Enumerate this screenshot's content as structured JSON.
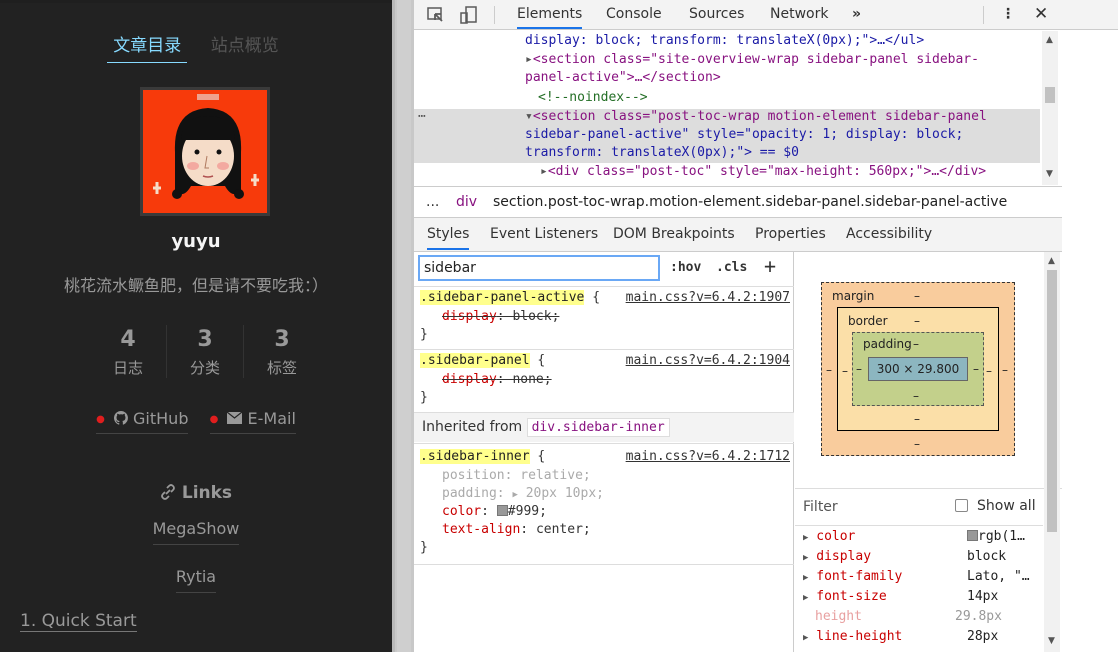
{
  "sidebar": {
    "tabs": {
      "toc": "文章目录",
      "overview": "站点概览"
    },
    "author": "yuyu",
    "description": "桃花流水鳜鱼肥，但是请不要吃我：）",
    "stats": [
      {
        "count": "4",
        "label": "日志"
      },
      {
        "count": "3",
        "label": "分类"
      },
      {
        "count": "3",
        "label": "标签"
      }
    ],
    "social": [
      {
        "label": "GitHub",
        "icon": "github-icon"
      },
      {
        "label": "E-Mail",
        "icon": "mail-icon"
      }
    ],
    "links_title": "Links",
    "links": [
      "MegaShow",
      "Rytia"
    ],
    "toc_item": "1. Quick Start"
  },
  "devtools": {
    "tabs": [
      "Elements",
      "Console",
      "Sources",
      "Network"
    ],
    "dom": {
      "line1": "display: block; transform: translateX(0px);\">…</ul>",
      "line2a": "<section class=\"site-overview-wrap sidebar-panel sidebar-",
      "line2b": "panel-active\">…</section>",
      "comment": "<!--noindex-->",
      "sel1": "<section class=\"post-toc-wrap motion-element sidebar-panel",
      "sel2": "sidebar-panel-active\" style=\"opacity: 1; display: block;",
      "sel3": "transform: translateX(0px);\"> == $0",
      "line5": "<div class=\"post-toc\" style=\"max-height: 560px;\">…</div>"
    },
    "breadcrumb": {
      "dots": "...",
      "div": "div",
      "current": "section.post-toc-wrap.motion-element.sidebar-panel.sidebar-panel-active"
    },
    "subtabs": [
      "Styles",
      "Event Listeners",
      "DOM Breakpoints",
      "Properties",
      "Accessibility"
    ],
    "filter_value": "sidebar",
    "hov": ":hov",
    "cls": ".cls",
    "rules": [
      {
        "selector": ".sidebar-panel-active",
        "source": "main.css?v=6.4.2:1907",
        "props": [
          {
            "name": "display",
            "value": "block;"
          }
        ]
      },
      {
        "selector": ".sidebar-panel",
        "source": "main.css?v=6.4.2:1904",
        "props": [
          {
            "name": "display",
            "value": "none;"
          }
        ]
      },
      {
        "selector": ".sidebar-inner",
        "source": "main.css?v=6.4.2:1712",
        "props": [
          {
            "name": "position",
            "value": "relative;"
          },
          {
            "name": "padding",
            "value": "20px 10px;"
          },
          {
            "name": "color",
            "value": "#999;"
          },
          {
            "name": "text-align",
            "value": "center;"
          }
        ]
      }
    ],
    "inherited_label": "Inherited from",
    "inherited_tag": "div.sidebar-inner",
    "boxmodel": {
      "margin": "margin",
      "border": "border",
      "padding": "padding",
      "content": "300 × 29.800",
      "dash": "–"
    },
    "computed_filter": "Filter",
    "show_all": "Show all",
    "computed": [
      {
        "name": "color",
        "value": "rgb(1…"
      },
      {
        "name": "display",
        "value": "block"
      },
      {
        "name": "font-family",
        "value": "Lato, \"…"
      },
      {
        "name": "font-size",
        "value": "14px"
      },
      {
        "name": "height",
        "value": "29.8px"
      },
      {
        "name": "line-height",
        "value": "28px"
      }
    ],
    "colors": {
      "accent": "#1a73e8",
      "selector_highlight": "#ffff8d",
      "margin": "#f9cc9d",
      "padding": "#c3d08b",
      "content": "#8cb6c0"
    }
  }
}
